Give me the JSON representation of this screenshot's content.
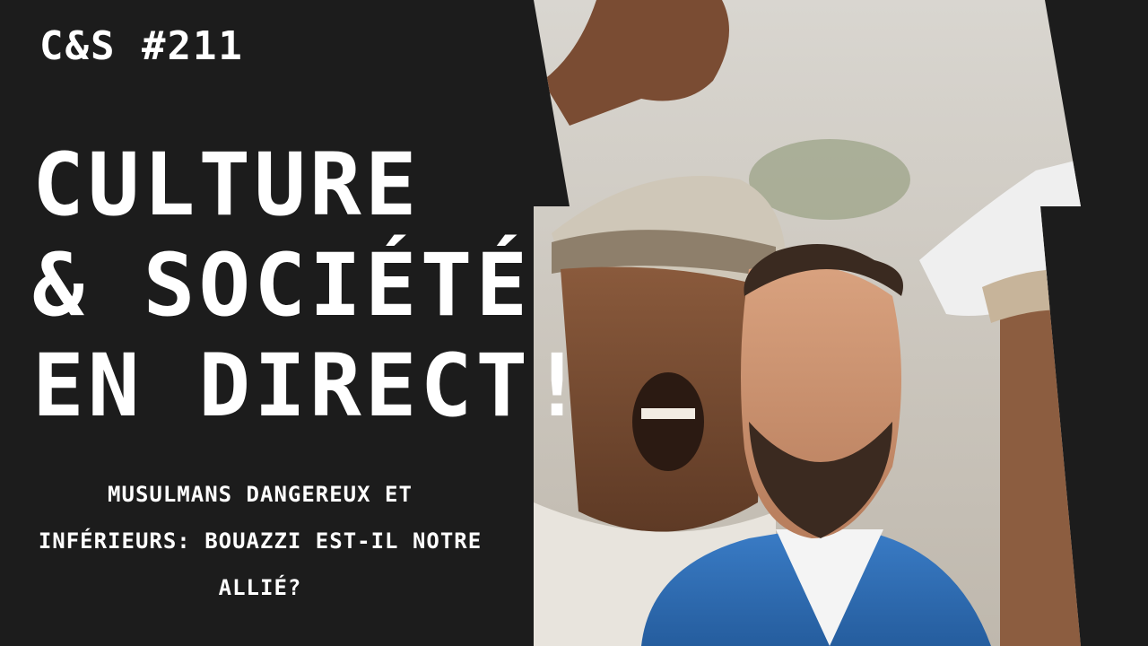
{
  "episode": "C&S #211",
  "headline": {
    "line1": "CULTURE",
    "line2": "& SOCIÉTÉ",
    "line3": "EN DIRECT!"
  },
  "subtitle": {
    "line1": "MUSULMANS DANGEREUX ET",
    "line2": "INFÉRIEURS: BOUAZZI EST-IL NOTRE",
    "line3": "ALLIÉ?"
  },
  "colors": {
    "background": "#1c1c1c",
    "text": "#ffffff",
    "blazer": "#2f6fb8"
  }
}
